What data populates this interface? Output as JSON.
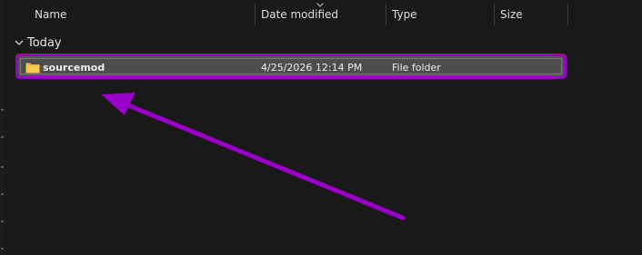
{
  "columns": {
    "name": "Name",
    "date_modified": "Date modified",
    "type": "Type",
    "size": "Size"
  },
  "group": {
    "label": "Today"
  },
  "rows": [
    {
      "name": "sourcemod",
      "date_modified": "4/25/2026 12:14 PM",
      "type": "File folder",
      "size": "",
      "icon": "folder-icon",
      "selected": true
    }
  ],
  "colors": {
    "background": "#191919",
    "highlight_border": "#9b00c9",
    "annotation_arrow": "#9b00c9",
    "folder": "#f3c646"
  }
}
